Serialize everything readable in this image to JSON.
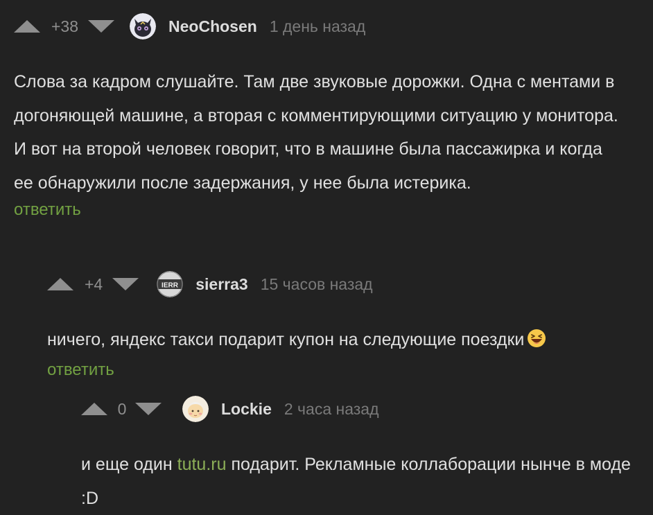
{
  "comments": [
    {
      "rating": "+38",
      "username": "NeoChosen",
      "time": "1 день назад",
      "text": "Слова за кадром слушайте. Там две звуковые дорожки. Одна с ментами в догоняющей машине, а вторая с комментирующими ситуацию у монитора. И вот на второй человек говорит, что в машине была пассажирка и когда ее обнаружили после задержания, у нее была истерика.",
      "reply_label": "ответить",
      "avatar_icon": "cat-avatar-icon"
    },
    {
      "rating": "+4",
      "username": "sierra3",
      "time": "15 часов назад",
      "text": "ничего, яндекс такси подарит купон на следующие поездки",
      "emoji": "laughing-face-emoji",
      "reply_label": "ответить",
      "avatar_icon": "sierra-avatar-icon"
    },
    {
      "rating": "0",
      "username": "Lockie",
      "time": "2 часа назад",
      "text_before": "и еще один ",
      "link_text": "tutu.ru",
      "text_after": " подарит. Рекламные коллаборации нынче в моде :D",
      "avatar_icon": "baby-avatar-icon"
    }
  ],
  "colors": {
    "background": "#222222",
    "text": "#e0e0e0",
    "muted": "#8f8f8f",
    "link": "#8cae57",
    "reply": "#72a142"
  },
  "icons": {
    "vote_up": "triangle-up-icon",
    "vote_down": "triangle-down-icon"
  }
}
